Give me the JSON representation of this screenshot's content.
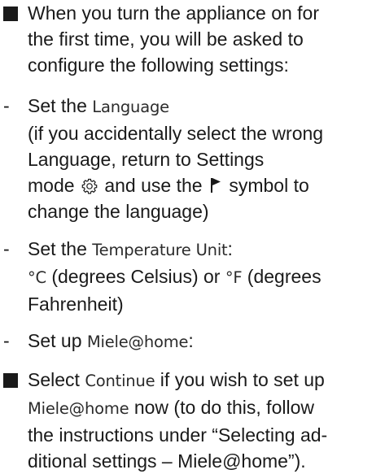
{
  "intro": {
    "line1": "When you turn the appliance on for",
    "line2": "the first time, you will be asked to",
    "line3": "configure the following settings:"
  },
  "language": {
    "label": "Set the ",
    "value": "Language",
    "note1": "(if you accidentally select the wrong",
    "note2": "Language, return to Settings",
    "note3_pre": "mode ",
    "note3_mid": " and use the ",
    "note3_post": " symbol to",
    "note4": "change the language)",
    "settings_icon": "gear-icon",
    "flag_icon": "flag-icon"
  },
  "temperature": {
    "label": "Set the ",
    "value": "Temperature Unit",
    "colon": ":",
    "c_unit": "°C",
    "c_text": " (degrees Celsius) or ",
    "f_unit": "°F",
    "f_text": " (degrees",
    "line3": "Fahrenheit)"
  },
  "mielehome": {
    "label": "Set up ",
    "value": "Miele@home",
    "colon": ":"
  },
  "continue": {
    "pre": "Select ",
    "value": "Continue",
    "post": " if you wish to set up",
    "line2_value": "Miele@home",
    "line2_post": " now (to do this, follow",
    "line3": "the instructions under “Selecting ad-",
    "line4": "ditional settings – Miele@home”)."
  },
  "dash_char": "-"
}
